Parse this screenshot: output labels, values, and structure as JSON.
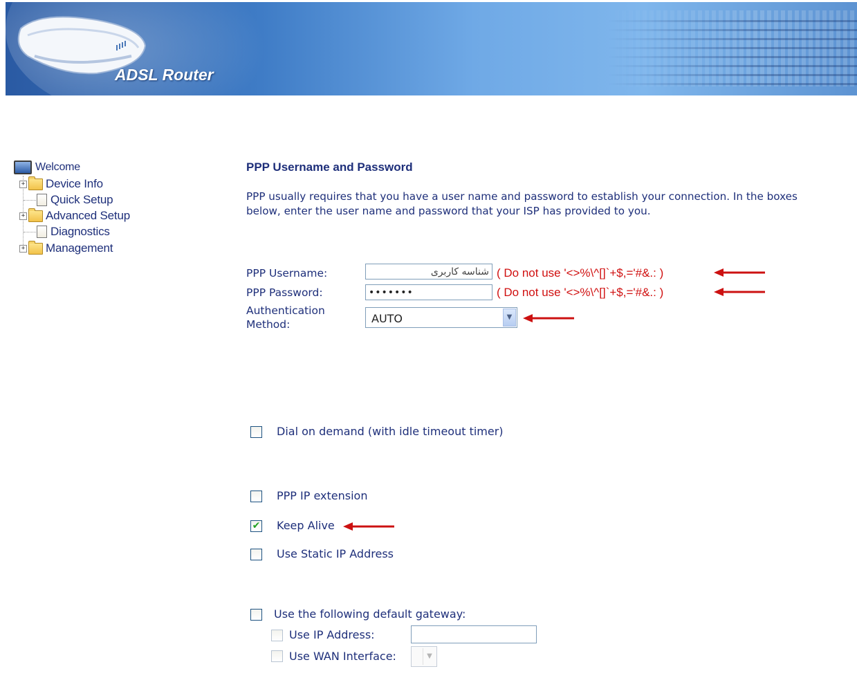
{
  "header": {
    "brand": "ADSL Router"
  },
  "sidebar": {
    "items": [
      {
        "label": "Welcome",
        "icon": "monitor-icon"
      },
      {
        "label": "Device Info",
        "icon": "folder-icon"
      },
      {
        "label": "Quick Setup",
        "icon": "page-icon"
      },
      {
        "label": "Advanced Setup",
        "icon": "folder-icon"
      },
      {
        "label": "Diagnostics",
        "icon": "page-icon"
      },
      {
        "label": "Management",
        "icon": "folder-icon"
      }
    ]
  },
  "main": {
    "title": "PPP Username and Password",
    "description": "PPP usually requires that you have a user name and password to establish your connection. In the boxes below, enter the user name and password that your ISP has provided to you.",
    "username": {
      "label": "PPP Username:",
      "value": "شناسه کاربری",
      "warning": "( Do not use '<>%\\^[]`+$,='#&.: )"
    },
    "password": {
      "label": "PPP Password:",
      "value": "•••••••",
      "warning": "( Do not use '<>%\\^[]`+$,='#&.: )"
    },
    "auth": {
      "label_line1": "Authentication",
      "label_line2": "Method:",
      "value": "AUTO"
    },
    "dial_on_demand": {
      "label": "Dial on demand (with idle timeout timer)",
      "checked": false
    },
    "ppp_ip_extension": {
      "label": "PPP IP extension",
      "checked": false
    },
    "keep_alive": {
      "label": "Keep Alive",
      "checked": true
    },
    "static_ip": {
      "label": "Use Static IP Address",
      "checked": false
    },
    "default_gateway": {
      "label": "Use the following default gateway:",
      "checked": false,
      "use_ip_address": {
        "label": "Use IP Address:",
        "value": ""
      },
      "use_wan_interface": {
        "label": "Use WAN Interface:",
        "value": ""
      }
    }
  },
  "colors": {
    "accent_text": "#1e2f7a",
    "warning": "#d01010",
    "arrow": "#cc1111",
    "banner": "#3f7cc6"
  }
}
